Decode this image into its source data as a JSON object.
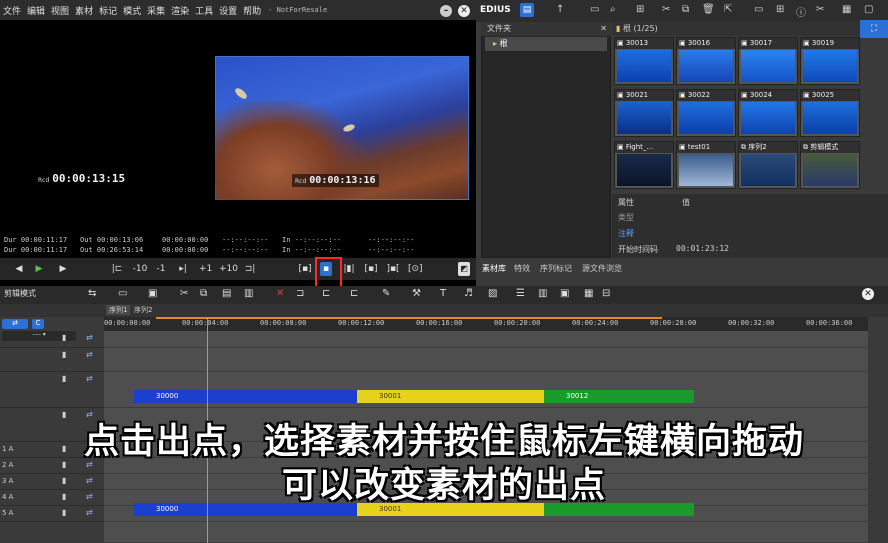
{
  "menu": {
    "items": [
      "文件",
      "编辑",
      "视图",
      "素材",
      "标记",
      "模式",
      "采集",
      "渲染",
      "工具",
      "设置",
      "帮助"
    ],
    "suffix": "- NotForResale"
  },
  "preview": {
    "left_tc_label": "Rcd",
    "left_tc": "00:00:13:15",
    "right_tc_label": "Rcd",
    "right_tc": "00:00:13:16"
  },
  "info": {
    "dur1": "Dur 00:00:11:17",
    "out1": "Out 00:00:13:06",
    "tc1": "00:00:00:00",
    "blank1": "--:--:--:--",
    "in1": "In --:--:--:--",
    "blank2": "--:--:--:--",
    "dur2": "Dur 00:00:11:17",
    "out2": "Out 00:26:53:14",
    "tc2": "00:00:00:00",
    "blank3": "--:--:--:--",
    "in2": "In --:--:--:--",
    "blank4": "--:--:--:--"
  },
  "transport": {
    "minus10": "-10",
    "minus1": "-1",
    "plus1": "+1",
    "plus10": "+10"
  },
  "bin": {
    "app": "EDIUS",
    "folder_header": "文件夹",
    "root": "根",
    "bin_header": "根 (1/25)",
    "thumbs": [
      {
        "label": "30013",
        "type": "video"
      },
      {
        "label": "30016",
        "type": "video"
      },
      {
        "label": "30017",
        "type": "video"
      },
      {
        "label": "30019",
        "type": "video"
      },
      {
        "label": "30021",
        "type": "video"
      },
      {
        "label": "30022",
        "type": "video"
      },
      {
        "label": "30024",
        "type": "video"
      },
      {
        "label": "30025",
        "type": "video"
      },
      {
        "label": "Fight_...",
        "type": "video"
      },
      {
        "label": "test01",
        "type": "video"
      },
      {
        "label": "序列2",
        "type": "sequence"
      },
      {
        "label": "剪辑模式",
        "type": "sequence"
      }
    ],
    "props": {
      "col1": "属性",
      "col2": "值",
      "row1": "类型",
      "row2": "注释",
      "row3_label": "开始时间码",
      "row3_value": "00:01:23:12"
    },
    "tabs": [
      "素材库",
      "特效",
      "序列标记",
      "源文件浏览"
    ]
  },
  "timeline": {
    "title": "剪辑模式",
    "seq_tabs": [
      "序列1",
      "序列2"
    ],
    "ruler": [
      "00:00:00:00",
      "00:00:04:00",
      "00:00:08:00",
      "00:00:12:00",
      "00:00:16:00",
      "00:00:20:00",
      "00:00:24:00",
      "00:00:28:00",
      "00:00:32:00",
      "00:00:36:00"
    ],
    "mode_value": "----",
    "track_labels": [
      "",
      "",
      "",
      "",
      "1 A",
      "2 A",
      "3 A",
      "4 A",
      "5 A"
    ],
    "clips_v": [
      {
        "label": "30000",
        "color": "#1c3fd0"
      },
      {
        "label": "30001",
        "color": "#e8d21a"
      },
      {
        "label": "30012",
        "color": "#1a9a2a"
      }
    ],
    "clips_a": [
      {
        "label": "30000",
        "color": "#1c3fd0"
      },
      {
        "label": "30001",
        "color": "#e8d21a"
      },
      {
        "label": "",
        "color": "#1a9a2a"
      }
    ]
  },
  "subtitle": {
    "line1": "点击出点，选择素材并按住鼠标左键横向拖动",
    "line2": "可以改变素材的出点"
  }
}
